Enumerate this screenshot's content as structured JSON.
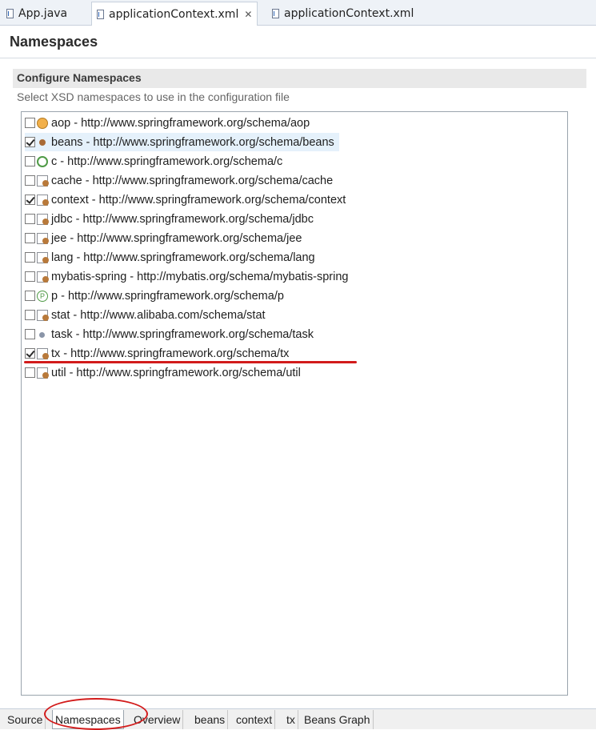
{
  "editor_tabs": [
    {
      "label": "App.java",
      "active": false
    },
    {
      "label": "applicationContext.xml",
      "active": true,
      "close": "✕"
    },
    {
      "label": "applicationContext.xml",
      "active": false
    }
  ],
  "page_title": "Namespaces",
  "section": {
    "title": "Configure Namespaces",
    "description": "Select XSD namespaces to use in the configuration file"
  },
  "namespaces": [
    {
      "label": "aop - http://www.springframework.org/schema/aop",
      "checked": false,
      "icon": "aop-icon"
    },
    {
      "label": "beans - http://www.springframework.org/schema/beans",
      "checked": true,
      "icon": "bean-icon",
      "selected": true
    },
    {
      "label": "c - http://www.springframework.org/schema/c",
      "checked": false,
      "icon": "c-namespace-icon"
    },
    {
      "label": "cache - http://www.springframework.org/schema/cache",
      "checked": false,
      "icon": "cache-icon"
    },
    {
      "label": "context - http://www.springframework.org/schema/context",
      "checked": true,
      "icon": "context-icon"
    },
    {
      "label": "jdbc - http://www.springframework.org/schema/jdbc",
      "checked": false,
      "icon": "jdbc-icon"
    },
    {
      "label": "jee - http://www.springframework.org/schema/jee",
      "checked": false,
      "icon": "jee-icon"
    },
    {
      "label": "lang - http://www.springframework.org/schema/lang",
      "checked": false,
      "icon": "lang-icon"
    },
    {
      "label": "mybatis-spring - http://mybatis.org/schema/mybatis-spring",
      "checked": false,
      "icon": "mybatis-icon"
    },
    {
      "label": "p - http://www.springframework.org/schema/p",
      "checked": false,
      "icon": "p-namespace-icon"
    },
    {
      "label": "stat - http://www.alibaba.com/schema/stat",
      "checked": false,
      "icon": "stat-icon"
    },
    {
      "label": "task - http://www.springframework.org/schema/task",
      "checked": false,
      "icon": "task-icon"
    },
    {
      "label": "tx - http://www.springframework.org/schema/tx",
      "checked": true,
      "icon": "tx-icon"
    },
    {
      "label": "util - http://www.springframework.org/schema/util",
      "checked": false,
      "icon": "util-icon"
    }
  ],
  "bottom_tabs": [
    {
      "label": "Source",
      "active": false
    },
    {
      "label": "Namespaces",
      "active": true
    },
    {
      "label": "Overview",
      "active": false
    },
    {
      "label": "beans",
      "active": false
    },
    {
      "label": "context",
      "active": false
    },
    {
      "label": "tx",
      "active": false
    },
    {
      "label": "Beans Graph",
      "active": false
    }
  ],
  "colors": {
    "annotation": "#d21b1b",
    "selection": "#e5f1fb"
  }
}
